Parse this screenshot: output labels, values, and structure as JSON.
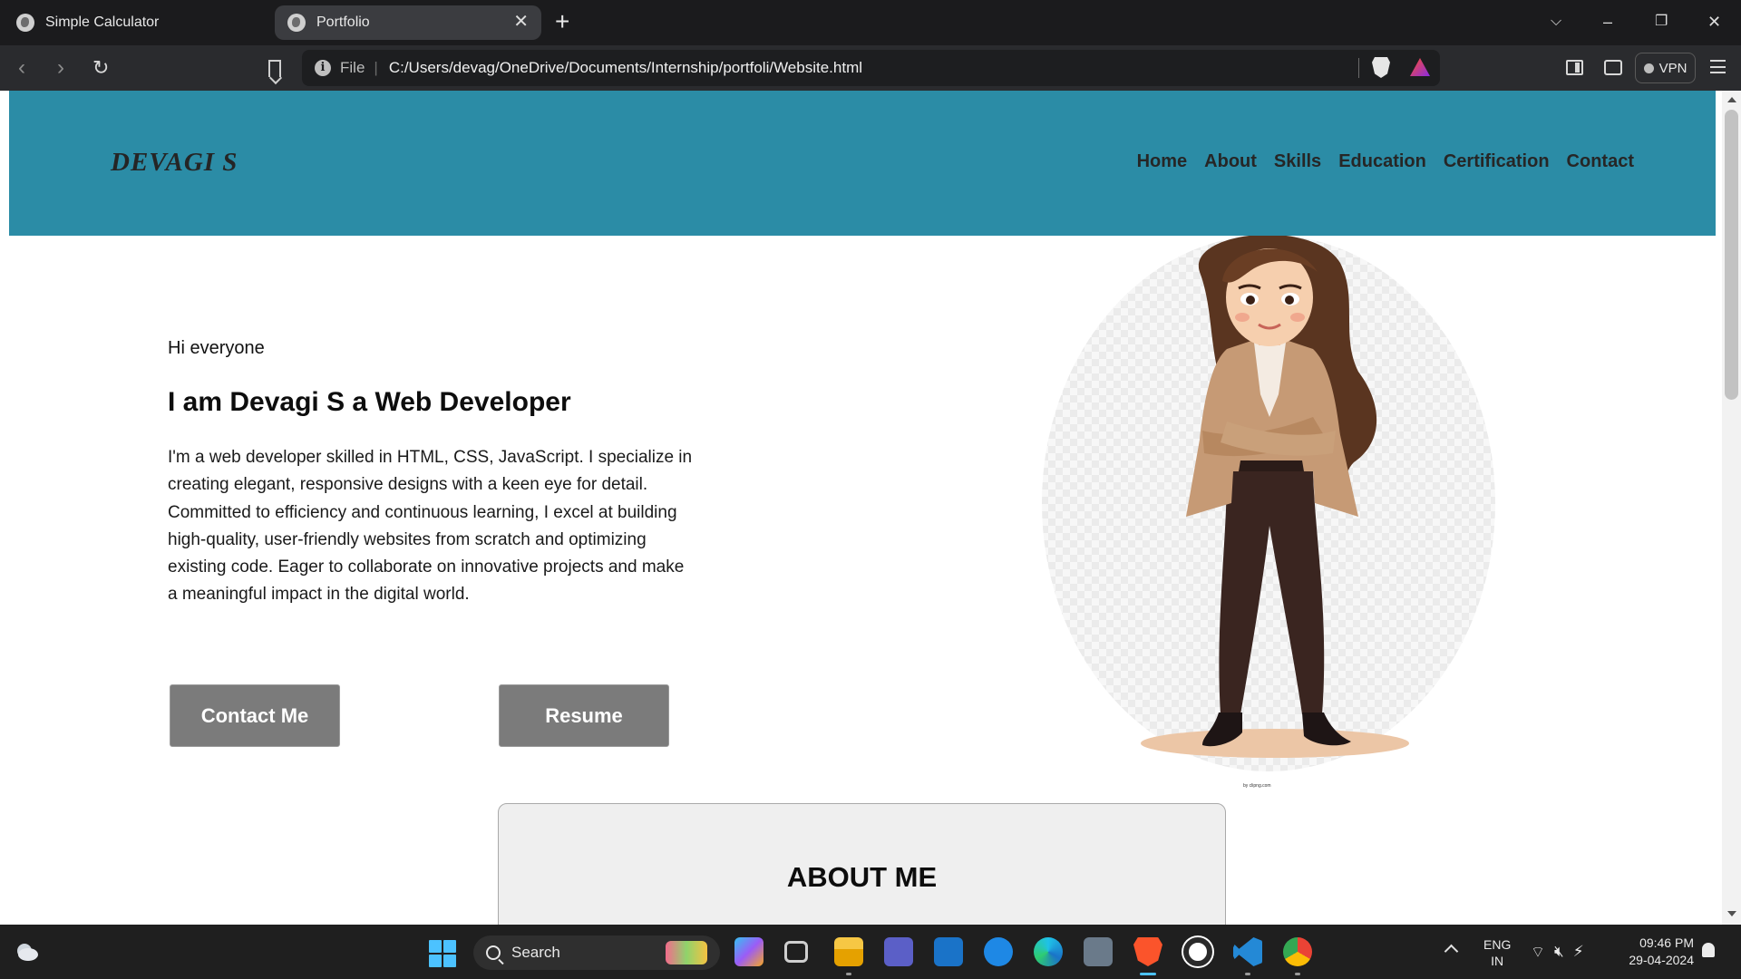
{
  "browser": {
    "tabs": [
      {
        "title": "Simple Calculator",
        "active": false
      },
      {
        "title": "Portfolio",
        "active": true
      }
    ],
    "address": {
      "label": "File",
      "url": "C:/Users/devag/OneDrive/Documents/Internship/portfoli/Website.html"
    },
    "vpn_label": "VPN",
    "window_controls": {
      "minimize": "–",
      "restore": "❐",
      "close": "✕"
    }
  },
  "site": {
    "logo": "DEVAGI S",
    "nav": [
      "Home",
      "About",
      "Skills",
      "Education",
      "Certification",
      "Contact"
    ],
    "colors": {
      "header_bg": "#2b8ca6",
      "button_bg": "#7b7b7b",
      "card_bg": "#efefef"
    }
  },
  "hero": {
    "greeting": "Hi everyone",
    "headline": "I am Devagi S a Web Developer",
    "bio": "I'm a web developer skilled in HTML, CSS, JavaScript. I specialize in creating elegant, responsive designs with a keen eye for detail. Committed to efficiency and continuous learning, I excel at building high-quality, user-friendly websites from scratch and optimizing existing code. Eager to collaborate on innovative projects and make a meaningful impact in the digital world.",
    "contact_button": "Contact Me",
    "resume_button": "Resume",
    "image_watermark": "by clipng.com"
  },
  "about": {
    "title": "ABOUT ME"
  },
  "taskbar": {
    "search_label": "Search",
    "language": {
      "line1": "ENG",
      "line2": "IN"
    },
    "time": "09:46 PM",
    "date": "29-04-2024",
    "pinned_icons": [
      "copilot-icon",
      "task-view-icon",
      "file-explorer-icon",
      "teams-icon",
      "myhp-icon",
      "help-icon",
      "edge-icon",
      "camera-icon",
      "brave-icon",
      "record-icon",
      "vscode-icon",
      "chrome-icon"
    ]
  }
}
